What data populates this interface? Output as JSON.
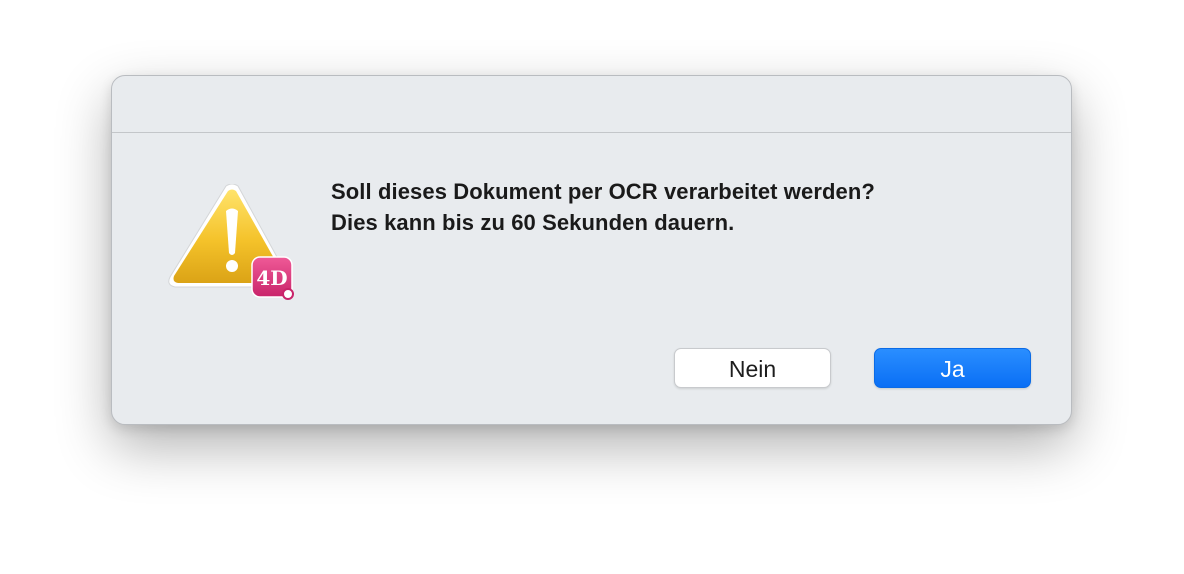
{
  "dialog": {
    "icon": "warning-triangle-icon",
    "badge_icon": "4d-app-badge-icon",
    "message_line1": "Soll dieses Dokument per OCR verarbeitet werden?",
    "message_line2": "Dies kann bis zu 60 Sekunden dauern.",
    "no_label": "Nein",
    "yes_label": "Ja"
  },
  "colors": {
    "dialog_bg": "#e8ebee",
    "primary_button": "#0a6ff5",
    "warning_yellow": "#f2c01e",
    "badge_pink": "#e0357a"
  }
}
